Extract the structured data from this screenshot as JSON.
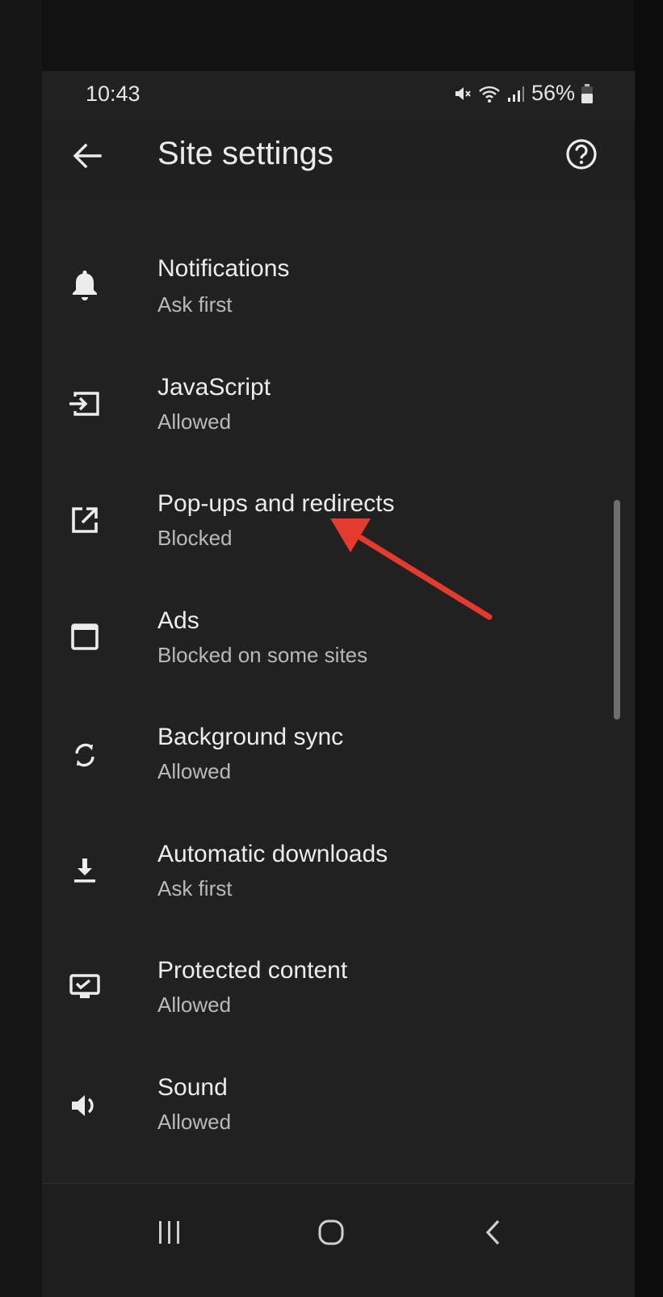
{
  "status_bar": {
    "time": "10:43",
    "battery": "56%"
  },
  "app_bar": {
    "title": "Site settings"
  },
  "items": [
    {
      "title": "Notifications",
      "subtitle": "Ask first",
      "icon": "bell-icon"
    },
    {
      "title": "JavaScript",
      "subtitle": "Allowed",
      "icon": "javascript-icon"
    },
    {
      "title": "Pop-ups and redirects",
      "subtitle": "Blocked",
      "icon": "open-in-new-icon"
    },
    {
      "title": "Ads",
      "subtitle": "Blocked on some sites",
      "icon": "window-icon"
    },
    {
      "title": "Background sync",
      "subtitle": "Allowed",
      "icon": "sync-icon"
    },
    {
      "title": "Automatic downloads",
      "subtitle": "Ask first",
      "icon": "download-icon"
    },
    {
      "title": "Protected content",
      "subtitle": "Allowed",
      "icon": "protected-content-icon"
    },
    {
      "title": "Sound",
      "subtitle": "Allowed",
      "icon": "volume-icon"
    }
  ],
  "annotation": {
    "color": "#e53a2e"
  },
  "nav_bar": {
    "buttons": [
      "recent-apps-icon",
      "home-icon",
      "back-icon"
    ]
  }
}
